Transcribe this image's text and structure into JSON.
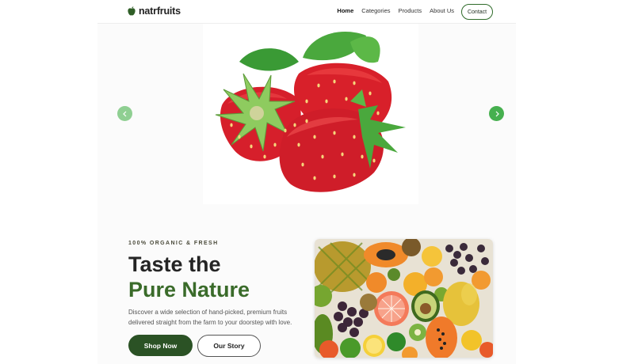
{
  "brand": {
    "name": "natrfruits",
    "logo_icon": "apple-icon"
  },
  "nav": {
    "items": [
      {
        "label": "Home",
        "active": true
      },
      {
        "label": "Categories",
        "active": false
      },
      {
        "label": "Products",
        "active": false
      },
      {
        "label": "About Us",
        "active": false
      }
    ],
    "contact_label": "Contact"
  },
  "hero": {
    "image": "strawberries",
    "prev_icon": "chevron-left-icon",
    "next_icon": "chevron-right-icon"
  },
  "intro": {
    "eyebrow": "100% ORGANIC & FRESH",
    "title_line1": "Taste the",
    "title_line2": "Pure Nature",
    "description": "Discover a wide selection of hand-picked, premium fruits delivered straight from the farm to your doorstep with love.",
    "primary_button": "Shop Now",
    "secondary_button": "Our Story",
    "image": "assorted-fruits"
  },
  "colors": {
    "primary": "#2b5225",
    "accent_green": "#3a6b2a",
    "arrow_green": "#46b04f"
  }
}
